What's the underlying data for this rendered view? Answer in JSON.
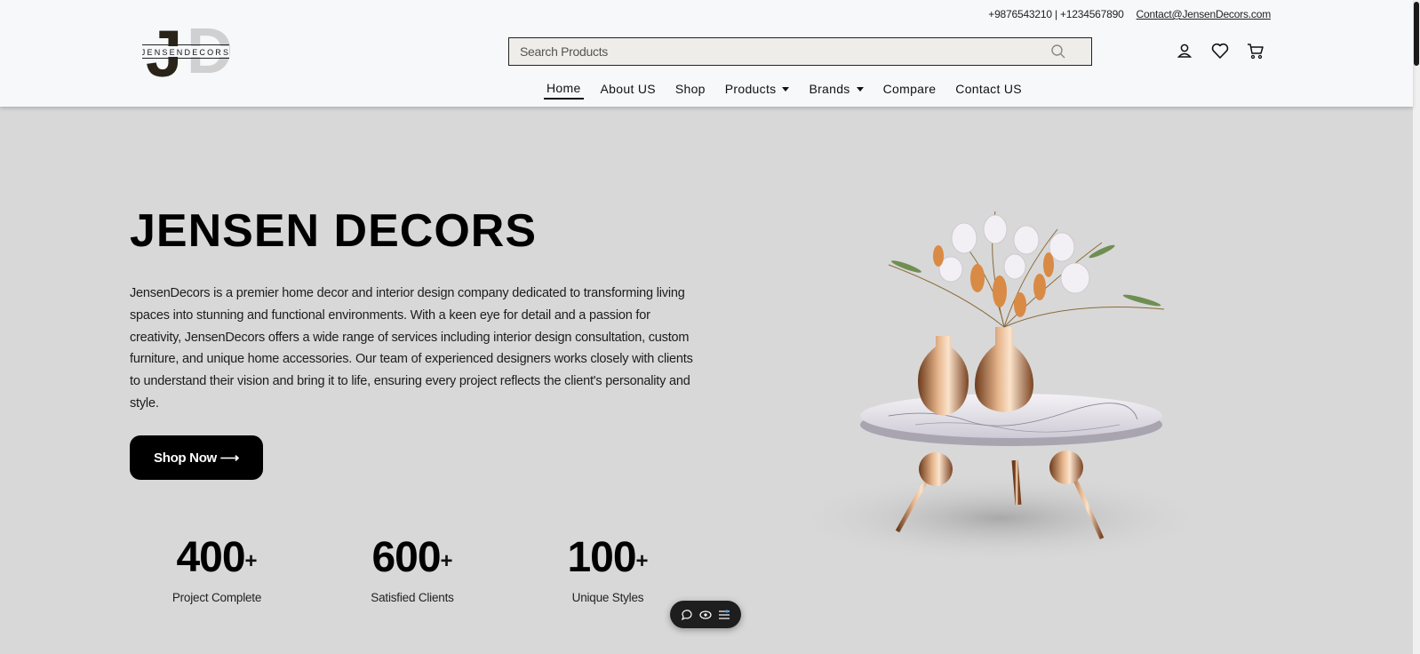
{
  "header": {
    "logo_text": "JENSENDECORS",
    "phone": "+9876543210 | +1234567890",
    "email": "Contact@JensenDecors.com",
    "search_placeholder": "Search Products",
    "nav": [
      {
        "label": "Home",
        "dropdown": false
      },
      {
        "label": "About US",
        "dropdown": false
      },
      {
        "label": "Shop",
        "dropdown": false
      },
      {
        "label": "Products",
        "dropdown": true
      },
      {
        "label": "Brands",
        "dropdown": true
      },
      {
        "label": "Compare",
        "dropdown": false
      },
      {
        "label": "Contact US",
        "dropdown": false
      }
    ],
    "icons": [
      "user-icon",
      "heart-icon",
      "cart-icon"
    ]
  },
  "hero": {
    "title": "JENSEN DECORS",
    "description": "JensenDecors is a premier home decor and interior design company dedicated to transforming living spaces into stunning and functional environments. With a keen eye for detail and a passion for creativity, JensenDecors offers a wide range of services including interior design consultation, custom furniture, and unique home accessories. Our team of experienced designers works closely with clients to understand their vision and bring it to life, ensuring every project reflects the client's personality and style.",
    "button_label": "Shop Now ⟶"
  },
  "stats": [
    {
      "value": "400",
      "suffix": "+",
      "label": "Project Complete"
    },
    {
      "value": "600",
      "suffix": "+",
      "label": "Satisfied Clients"
    },
    {
      "value": "100",
      "suffix": "+",
      "label": "Unique Styles"
    }
  ],
  "colors": {
    "header_bg": "#f7f8fa",
    "page_bg": "#d8d8d8",
    "button_bg": "#000000",
    "search_bg": "#efedea"
  }
}
